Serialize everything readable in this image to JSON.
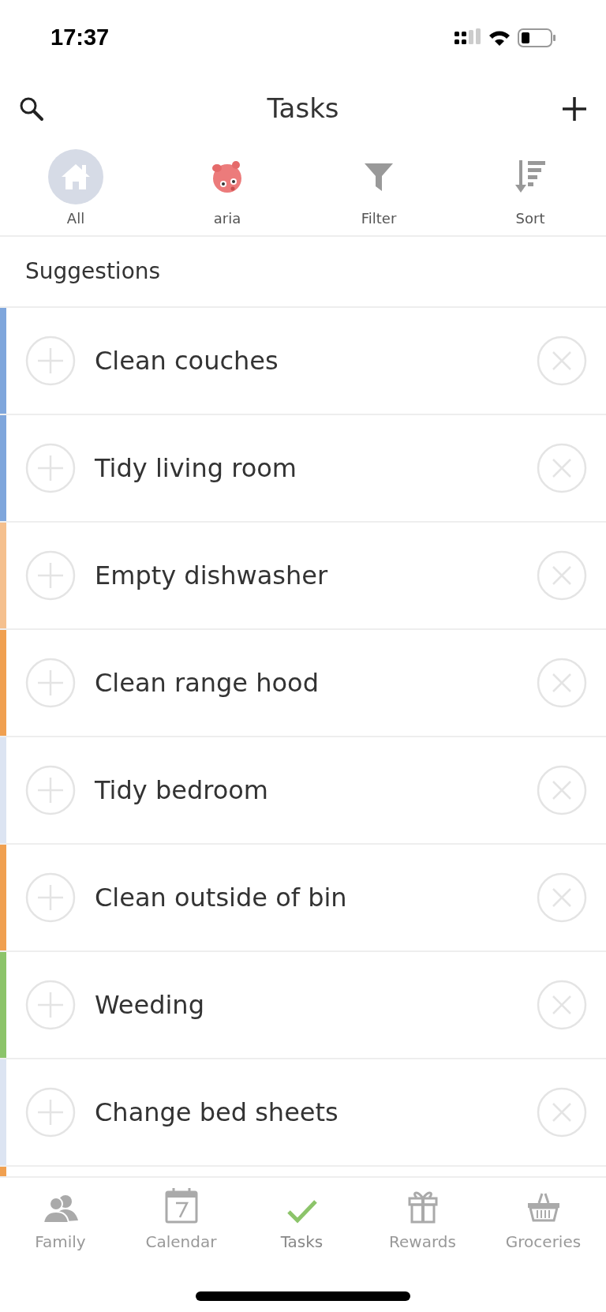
{
  "status_bar": {
    "time": "17:37"
  },
  "header": {
    "title": "Tasks"
  },
  "filters": [
    {
      "kind": "home",
      "label": "All",
      "selected": true
    },
    {
      "kind": "avatar",
      "label": "aria",
      "selected": false
    },
    {
      "kind": "filter",
      "label": "Filter",
      "selected": false
    },
    {
      "kind": "sort",
      "label": "Sort",
      "selected": false
    }
  ],
  "section": {
    "title": "Suggestions"
  },
  "suggestions": [
    {
      "title": "Clean couches",
      "color": "#7fa6dc"
    },
    {
      "title": "Tidy living room",
      "color": "#7fa6dc"
    },
    {
      "title": "Empty dishwasher",
      "color": "#f5c08e"
    },
    {
      "title": "Clean range hood",
      "color": "#f0a050"
    },
    {
      "title": "Tidy bedroom",
      "color": "#dce4f2"
    },
    {
      "title": "Clean outside of bin",
      "color": "#f0a050"
    },
    {
      "title": "Weeding",
      "color": "#8cc46a"
    },
    {
      "title": "Change bed sheets",
      "color": "#dce4f2"
    }
  ],
  "cut_off_item": {
    "color": "#f0a050"
  },
  "tab_bar": [
    {
      "kind": "family",
      "label": "Family",
      "selected": false
    },
    {
      "kind": "calendar",
      "label": "Calendar",
      "selected": false
    },
    {
      "kind": "tasks",
      "label": "Tasks",
      "selected": true
    },
    {
      "kind": "rewards",
      "label": "Rewards",
      "selected": false
    },
    {
      "kind": "groceries",
      "label": "Groceries",
      "selected": false
    }
  ]
}
